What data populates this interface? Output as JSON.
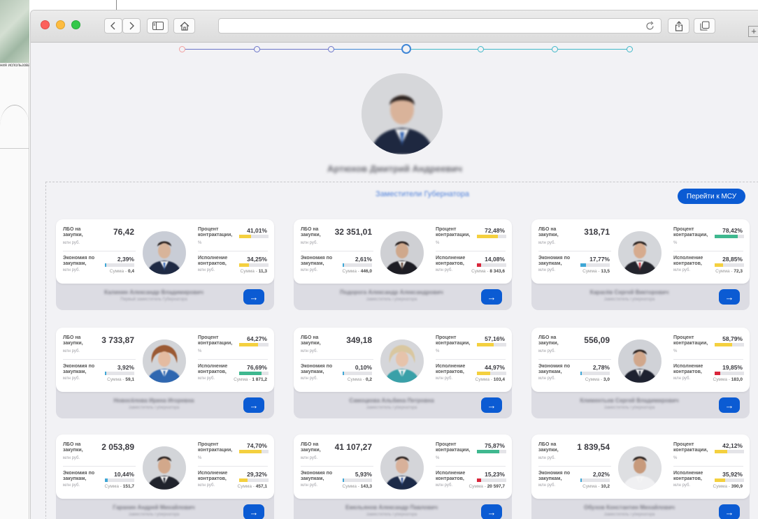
{
  "desktop": {
    "caption": "ния использоват"
  },
  "browser": {
    "plus": "+"
  },
  "page": {
    "main_person_name": "Артюхов Дмитрий Андреевич",
    "section_title": "Заместители Губернатора",
    "msu_button": "Перейти к МСУ",
    "steps": [
      {
        "color": "#f2a0a0",
        "active": false
      },
      {
        "color": "#6b74c9",
        "active": false
      },
      {
        "color": "#6b74c9",
        "active": false
      },
      {
        "color": "#3f86d6",
        "active": true
      },
      {
        "color": "#40b8c8",
        "active": false
      },
      {
        "color": "#40b8c8",
        "active": false
      },
      {
        "color": "#40b8c8",
        "active": false
      }
    ]
  },
  "labels": {
    "lbo": "ЛБО на закупки,",
    "mln": "млн руб.",
    "percent_contract": "Процент контрактации,",
    "percent_unit": "%",
    "economy": "Экономия по закупкам,",
    "execution": "Исполнение контрактов,",
    "sum": "Сумма - ",
    "arrow": "→"
  },
  "cards": [
    {
      "lbo": "76,42",
      "pct": "41,01%",
      "pct_fill": 0.41,
      "pct_color": "#f4d03f",
      "econ": "2,39%",
      "econ_fill": 0.024,
      "econ_sum": "0,4",
      "exec": "34,25%",
      "exec_fill": 0.34,
      "exec_color": "#f4d03f",
      "exec_sum": "11,3",
      "name": "Калинин Александр Владимирович",
      "role": "Первый заместитель Губернатора",
      "avatar_bg": "#c9cdd6",
      "suit": "#1f2a44",
      "skin": "#d8b49a",
      "tie": "#2a5db0"
    },
    {
      "lbo": "32 351,01",
      "pct": "72,48%",
      "pct_fill": 0.72,
      "pct_color": "#f4d03f",
      "econ": "2,61%",
      "econ_fill": 0.026,
      "econ_sum": "446,0",
      "exec": "14,08%",
      "exec_fill": 0.14,
      "exec_color": "#d9263b",
      "exec_sum": "8 343,6",
      "name": "Подорога Александр Александрович",
      "role": "Заместитель Губернатора",
      "avatar_bg": "#cfd0d4",
      "suit": "#1d1d24",
      "skin": "#cfa88c",
      "tie": "#5a3a2a"
    },
    {
      "lbo": "318,71",
      "pct": "78,42%",
      "pct_fill": 0.78,
      "pct_color": "#3fb88f",
      "econ": "17,77%",
      "econ_fill": 0.18,
      "econ_sum": "13,5",
      "exec": "28,85%",
      "exec_fill": 0.29,
      "exec_color": "#f4d03f",
      "exec_sum": "72,3",
      "name": "Карасёв Сергей Викторович",
      "role": "Заместитель Губернатора",
      "avatar_bg": "#d4d6da",
      "suit": "#23242c",
      "skin": "#d6ab8e",
      "tie": "#c2222f"
    },
    {
      "lbo": "3 733,87",
      "pct": "64,27%",
      "pct_fill": 0.64,
      "pct_color": "#f4d03f",
      "econ": "3,92%",
      "econ_fill": 0.039,
      "econ_sum": "59,1",
      "exec": "76,69%",
      "exec_fill": 0.77,
      "exec_color": "#3fb88f",
      "exec_sum": "1 871,2",
      "name": "Новосёлова Ирина Игоревна",
      "role": "Заместитель Губернатора",
      "avatar_bg": "#d2d4d8",
      "suit": "#2f67b0",
      "skin": "#e4bba0",
      "tie": "#2f67b0",
      "hair": "#9b5a34"
    },
    {
      "lbo": "349,18",
      "pct": "57,16%",
      "pct_fill": 0.57,
      "pct_color": "#f4d03f",
      "econ": "0,10%",
      "econ_fill": 0.01,
      "econ_sum": "0,2",
      "exec": "44,97%",
      "exec_fill": 0.45,
      "exec_color": "#f4d03f",
      "exec_sum": "103,4",
      "name": "Самоцкова Альбина Петровна",
      "role": "Заместитель Губернатора",
      "avatar_bg": "#d5d6da",
      "suit": "#3aa0a8",
      "skin": "#e6c3ab",
      "tie": "#3aa0a8",
      "hair": "#d9c7a0"
    },
    {
      "lbo": "556,09",
      "pct": "58,79%",
      "pct_fill": 0.59,
      "pct_color": "#f4d03f",
      "econ": "2,78%",
      "econ_fill": 0.028,
      "econ_sum": "3,0",
      "exec": "19,85%",
      "exec_fill": 0.2,
      "exec_color": "#d9263b",
      "exec_sum": "183,0",
      "name": "Климентьев Сергей Владимирович",
      "role": "Заместитель Губернатора",
      "avatar_bg": "#d0d2d7",
      "suit": "#1e2230",
      "skin": "#d1a78b",
      "tie": "#333a4a"
    },
    {
      "lbo": "2 053,89",
      "pct": "74,70%",
      "pct_fill": 0.75,
      "pct_color": "#f4d03f",
      "econ": "10,44%",
      "econ_fill": 0.1,
      "econ_sum": "151,7",
      "exec": "29,32%",
      "exec_fill": 0.29,
      "exec_color": "#f4d03f",
      "exec_sum": "457,1",
      "name": "Гаранин Андрей Михайлович",
      "role": "Заместитель Губернатора",
      "avatar_bg": "#d3d5d9",
      "suit": "#20232c",
      "skin": "#d2a88b",
      "tie": "#222630"
    },
    {
      "lbo": "41 107,27",
      "pct": "75,87%",
      "pct_fill": 0.76,
      "pct_color": "#3fb88f",
      "econ": "5,93%",
      "econ_fill": 0.059,
      "econ_sum": "143,3",
      "exec": "15,23%",
      "exec_fill": 0.15,
      "exec_color": "#d9263b",
      "exec_sum": "20 597,7",
      "name": "Емельянов Александр Павлович",
      "role": "Заместитель Губернатора",
      "avatar_bg": "#d4d5d9",
      "suit": "#1c2a48",
      "skin": "#d8b19a",
      "tie": "#2a4f9c"
    },
    {
      "lbo": "1 839,54",
      "pct": "42,12%",
      "pct_fill": 0.42,
      "pct_color": "#f4d03f",
      "econ": "2,02%",
      "econ_fill": 0.02,
      "econ_sum": "10,2",
      "exec": "35,92%",
      "exec_fill": 0.36,
      "exec_color": "#f4d03f",
      "exec_sum": "390,9",
      "name": "Обухов Константин Михайлович",
      "role": "Заместитель Губернатора",
      "avatar_bg": "#dedfe2",
      "suit": "#f0f0f2",
      "skin": "#c79a7c",
      "tie": "#f0f0f2"
    }
  ]
}
